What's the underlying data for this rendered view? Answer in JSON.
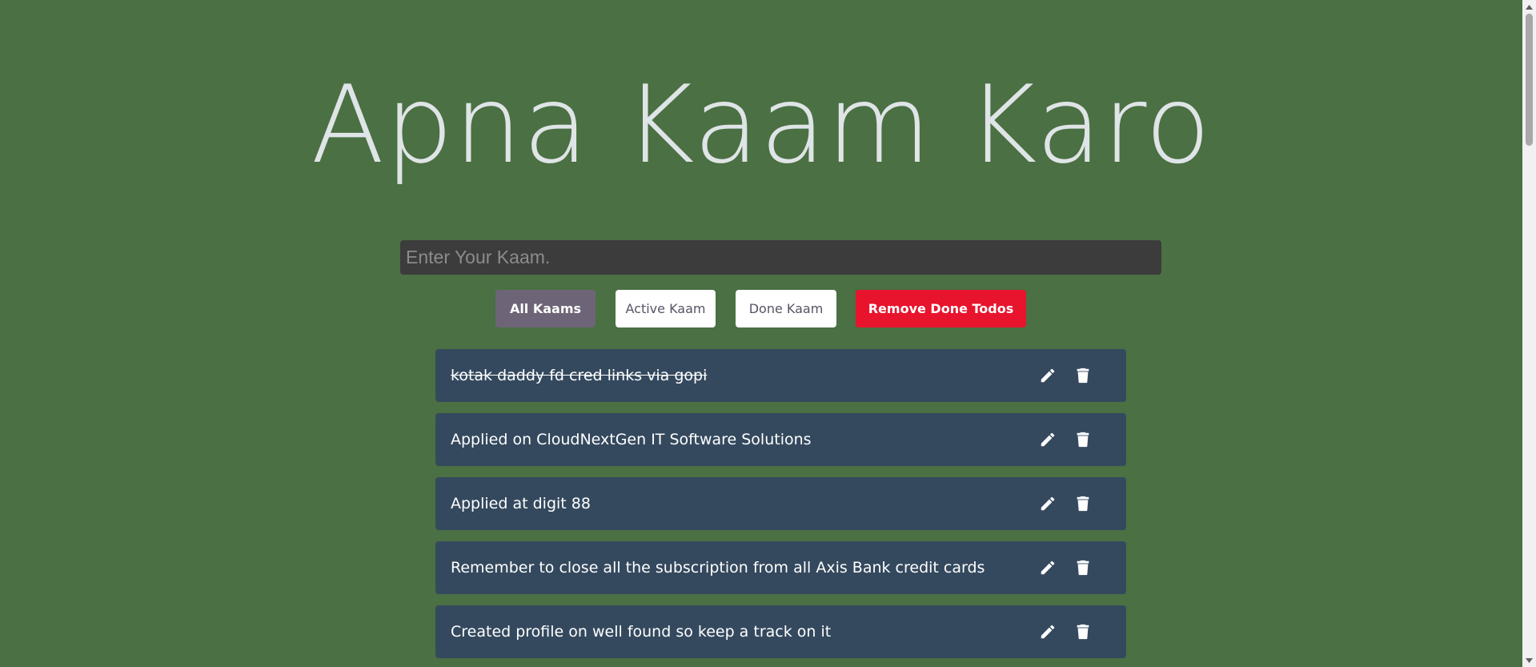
{
  "header": {
    "title": "Apna Kaam Karo"
  },
  "input": {
    "placeholder": "Enter Your Kaam.",
    "value": ""
  },
  "filters": {
    "all_label": "All Kaams",
    "active_label": "Active Kaam",
    "done_label": "Done Kaam",
    "remove_done_label": "Remove Done Todos",
    "selected": "All Kaams"
  },
  "todos": [
    {
      "text": "kotak daddy fd cred links via gopi",
      "done": true
    },
    {
      "text": "Applied on CloudNextGen IT Software Solutions",
      "done": false
    },
    {
      "text": "Applied at digit 88",
      "done": false
    },
    {
      "text": "Remember to close all the subscription from all Axis Bank credit cards",
      "done": false
    },
    {
      "text": "Created profile on well found so keep a track on it",
      "done": false
    }
  ],
  "icons": {
    "edit": "pencil-icon",
    "delete": "trash-icon"
  },
  "colors": {
    "background": "#4a7043",
    "todo_background": "#34495e",
    "remove_button": "#e8142e",
    "selected_filter": "#6d6577"
  }
}
